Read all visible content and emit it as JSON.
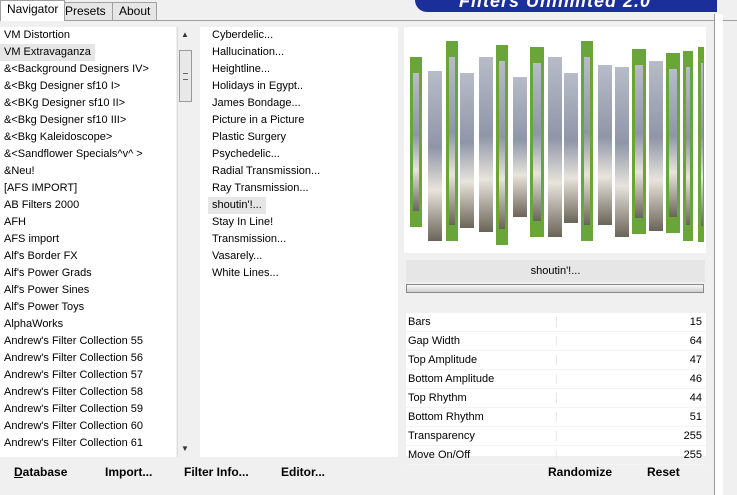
{
  "tabs": [
    {
      "label": "Navigator"
    },
    {
      "label": "Presets"
    },
    {
      "label": "About"
    }
  ],
  "app_title": "Filters Unlimited 2.0",
  "categories": [
    "VM Distortion",
    "VM Extravaganza",
    "&<Background Designers IV>",
    "&<Bkg Designer sf10 I>",
    "&<BKg Designer sf10 II>",
    "&<Bkg Designer sf10 III>",
    "&<Bkg Kaleidoscope>",
    "&<Sandflower Specials^v^ >",
    "&Neu!",
    "[AFS IMPORT]",
    "AB Filters 2000",
    "AFH",
    "AFS import",
    "Alf's Border FX",
    "Alf's Power Grads",
    "Alf's Power Sines",
    "Alf's Power Toys",
    "AlphaWorks",
    "Andrew's Filter Collection 55",
    "Andrew's Filter Collection 56",
    "Andrew's Filter Collection 57",
    "Andrew's Filter Collection 58",
    "Andrew's Filter Collection 59",
    "Andrew's Filter Collection 60",
    "Andrew's Filter Collection 61"
  ],
  "selected_category_index": 1,
  "filters": [
    "Cyberdelic...",
    "Hallucination...",
    "Heightline...",
    "Holidays in Egypt..",
    "James Bondage...",
    "Picture in a Picture",
    "Plastic Surgery",
    "Psychedelic...",
    "Radial Transmission...",
    "Ray Transmission...",
    "shoutin'!...",
    "Stay In Line!",
    "Transmission...",
    "Vasarely...",
    "White Lines..."
  ],
  "selected_filter_index": 10,
  "current_filter": "shoutin'!...",
  "progress_fraction": 1.0,
  "parameters": [
    {
      "label": "Bars",
      "value": "15"
    },
    {
      "label": "Gap Width",
      "value": "64"
    },
    {
      "label": "Top Amplitude",
      "value": "47"
    },
    {
      "label": "Bottom Amplitude",
      "value": "46"
    },
    {
      "label": "Top Rhythm",
      "value": "44"
    },
    {
      "label": "Bottom Rhythm",
      "value": "51"
    },
    {
      "label": "Transparency",
      "value": "255"
    },
    {
      "label": "Move On/Off",
      "value": "255"
    }
  ],
  "buttons": {
    "database": "Database",
    "import": "Import...",
    "filter_info": "Filter Info...",
    "editor": "Editor...",
    "randomize": "Randomize",
    "reset": "Reset"
  },
  "colors": {
    "title_banner": "#1a2f9a",
    "bar_green": "#6aa53a",
    "selection": "#e6e6e6"
  }
}
